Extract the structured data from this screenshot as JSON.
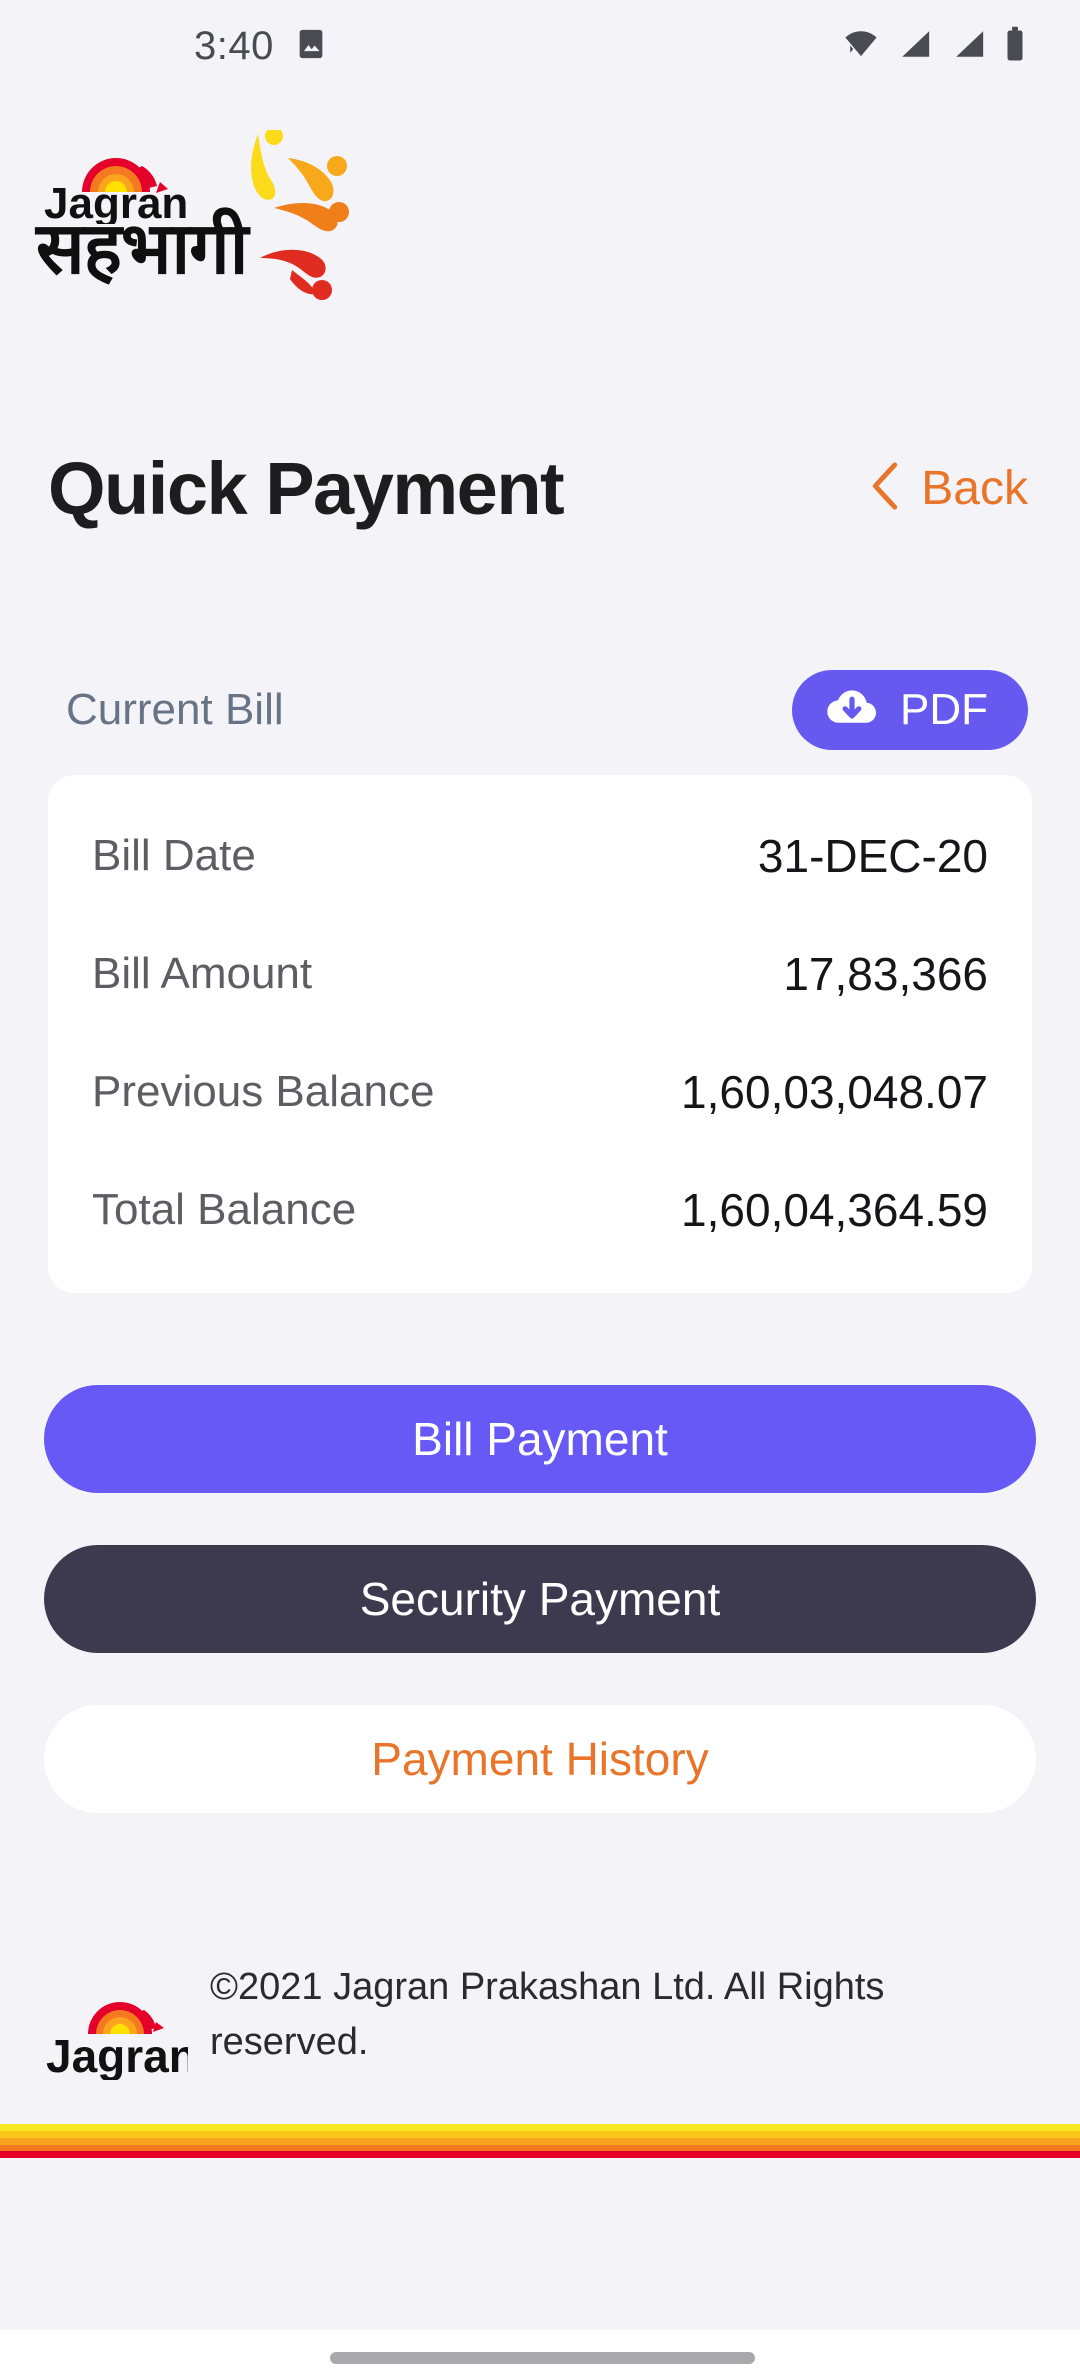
{
  "status_bar": {
    "time": "3:40",
    "icons": [
      "image-icon",
      "wifi-icon",
      "signal-icon",
      "signal-icon",
      "battery-icon"
    ]
  },
  "brand": {
    "name_en": "Jagran",
    "name_hi": "सहभागी",
    "logo_icon": "jagran-sun-logo",
    "decoration_icon": "celebration-figures-icon"
  },
  "header": {
    "title": "Quick Payment",
    "back_label": "Back",
    "back_icon": "chevron-left-icon"
  },
  "section": {
    "label": "Current Bill",
    "pdf_label": "PDF",
    "pdf_icon": "cloud-download-icon"
  },
  "bill": {
    "rows": [
      {
        "key": "Bill Date",
        "value": "31-DEC-20"
      },
      {
        "key": "Bill Amount",
        "value": "17,83,366"
      },
      {
        "key": "Previous Balance",
        "value": "1,60,03,048.07"
      },
      {
        "key": "Total Balance",
        "value": "1,60,04,364.59"
      }
    ]
  },
  "actions": {
    "bill_payment": "Bill Payment",
    "security_payment": "Security Payment",
    "payment_history": "Payment History"
  },
  "footer": {
    "copyright": "©2021 Jagran Prakashan Ltd. All Rights reserved.",
    "logo_icon": "jagran-sun-logo"
  },
  "colors": {
    "background": "#f4f3f7",
    "card": "#ffffff",
    "accent_purple": "#6659f5",
    "accent_dark": "#3d3a4f",
    "accent_orange": "#e8752a",
    "label_gray": "#687485",
    "stripe_yellow": "#f9e81f",
    "stripe_gold": "#fbc61a",
    "stripe_amber": "#faa41d",
    "stripe_orange": "#f47920",
    "stripe_red": "#e4002b"
  }
}
